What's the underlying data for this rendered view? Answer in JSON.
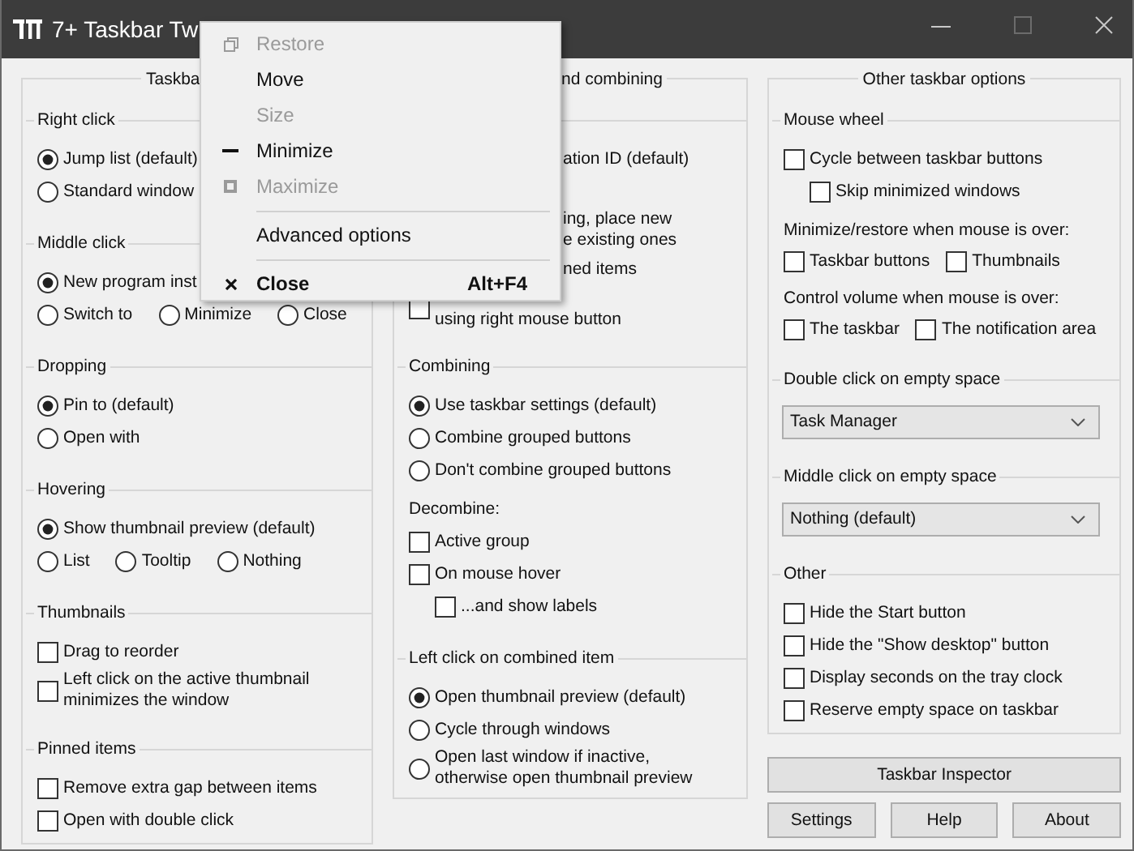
{
  "window": {
    "title": "7+ Taskbar Tw"
  },
  "columns": [
    {
      "title": "Taskba",
      "sections": [
        {
          "header": "Right click",
          "rows": [
            {
              "kind": "radio",
              "label": "Jump list (default)",
              "selected": true
            },
            {
              "kind": "radio",
              "label": "Standard window",
              "selected": false
            }
          ]
        },
        {
          "header": "Middle click",
          "rows": [
            {
              "kind": "radio",
              "label": "New program inst",
              "selected": true
            },
            {
              "kind": "radios",
              "options": [
                {
                  "label": "Switch to",
                  "selected": false
                },
                {
                  "label": "Minimize",
                  "selected": false
                },
                {
                  "label": "Close",
                  "selected": false
                }
              ]
            }
          ]
        },
        {
          "header": "Dropping",
          "rows": [
            {
              "kind": "radio",
              "label": "Pin to (default)",
              "selected": true
            },
            {
              "kind": "radio",
              "label": "Open with",
              "selected": false
            }
          ]
        },
        {
          "header": "Hovering",
          "rows": [
            {
              "kind": "radio",
              "label": "Show thumbnail preview (default)",
              "selected": true
            },
            {
              "kind": "radios",
              "options": [
                {
                  "label": "List",
                  "selected": false
                },
                {
                  "label": "Tooltip",
                  "selected": false
                },
                {
                  "label": "Nothing",
                  "selected": false
                }
              ]
            }
          ]
        },
        {
          "header": "Thumbnails",
          "rows": [
            {
              "kind": "check",
              "label": "Drag to reorder",
              "checked": false
            },
            {
              "kind": "check",
              "label": "Left click on the active thumbnail\nminimizes the window",
              "checked": false
            }
          ]
        },
        {
          "header": "Pinned items",
          "rows": [
            {
              "kind": "check",
              "label": "Remove extra gap between items",
              "checked": false
            },
            {
              "kind": "check",
              "label": "Open with double click",
              "checked": false
            }
          ]
        }
      ]
    },
    {
      "title": "nd combining",
      "sections": [
        {
          "rows": [
            {
              "kind": "cut",
              "label": "ation ID (default)"
            },
            {
              "kind": "cut",
              "label": "ing, place new\ne existing ones"
            },
            {
              "kind": "cut",
              "label": "ned items"
            },
            {
              "kind": "check-cut",
              "label": "using right mouse button",
              "checked": false
            }
          ]
        },
        {
          "header": "Combining",
          "rows": [
            {
              "kind": "radio",
              "label": "Use taskbar settings (default)",
              "selected": true
            },
            {
              "kind": "radio",
              "label": "Combine grouped buttons",
              "selected": false
            },
            {
              "kind": "radio",
              "label": "Don't combine grouped buttons",
              "selected": false
            },
            {
              "kind": "note",
              "label": "Decombine:"
            },
            {
              "kind": "check",
              "label": "Active group",
              "checked": false
            },
            {
              "kind": "check",
              "label": "On mouse hover",
              "checked": false,
              "children": [
                {
                  "label": "...and show labels",
                  "checked": false
                }
              ]
            }
          ]
        },
        {
          "header": "Left click on combined item",
          "rows": [
            {
              "kind": "radio",
              "label": "Open thumbnail preview (default)",
              "selected": true
            },
            {
              "kind": "radio",
              "label": "Cycle through windows",
              "selected": false
            },
            {
              "kind": "radio",
              "label": "Open last window if inactive,\notherwise open thumbnail preview",
              "selected": false
            }
          ]
        }
      ]
    },
    {
      "title": "Other taskbar options",
      "sections": [
        {
          "header": "Mouse wheel",
          "rows": [
            {
              "kind": "check",
              "label": "Cycle between taskbar buttons",
              "checked": false,
              "children": [
                {
                  "label": "Skip minimized windows",
                  "checked": false
                }
              ]
            },
            {
              "kind": "note",
              "label": "Minimize/restore when mouse is over:"
            },
            {
              "kind": "checks",
              "options": [
                {
                  "label": "Taskbar buttons",
                  "checked": false
                },
                {
                  "label": "Thumbnails",
                  "checked": false
                }
              ]
            },
            {
              "kind": "note",
              "label": "Control volume when mouse is over:"
            },
            {
              "kind": "checks",
              "options": [
                {
                  "label": "The taskbar",
                  "checked": false
                },
                {
                  "label": "The notification area",
                  "checked": false
                }
              ]
            }
          ]
        },
        {
          "header": "Double click on empty space",
          "rows": [
            {
              "kind": "select",
              "value": "Task Manager"
            }
          ]
        },
        {
          "header": "Middle click on empty space",
          "rows": [
            {
              "kind": "select",
              "value": "Nothing (default)"
            }
          ]
        },
        {
          "header": "Other",
          "rows": [
            {
              "kind": "check",
              "label": "Hide the Start button",
              "checked": false
            },
            {
              "kind": "check",
              "label": "Hide the \"Show desktop\" button",
              "checked": false
            },
            {
              "kind": "check",
              "label": "Display seconds on the tray clock",
              "checked": false
            },
            {
              "kind": "check",
              "label": "Reserve empty space on taskbar",
              "checked": false
            }
          ]
        }
      ]
    }
  ],
  "inspector_button": "Taskbar Inspector",
  "buttons": [
    "Settings",
    "Help",
    "About"
  ],
  "menu": {
    "items": [
      {
        "kind": "restore",
        "label": "Restore",
        "disabled": true
      },
      {
        "kind": "plain",
        "label": "Move",
        "disabled": false
      },
      {
        "kind": "plain",
        "label": "Size",
        "disabled": true
      },
      {
        "kind": "minimize",
        "label": "Minimize",
        "disabled": false
      },
      {
        "kind": "maximize",
        "label": "Maximize",
        "disabled": true
      },
      {
        "kind": "separator"
      },
      {
        "kind": "plain",
        "label": "Advanced options",
        "disabled": false
      },
      {
        "kind": "separator"
      },
      {
        "kind": "close",
        "label": "Close",
        "shortcut": "Alt+F4",
        "disabled": false,
        "default": true
      }
    ]
  }
}
